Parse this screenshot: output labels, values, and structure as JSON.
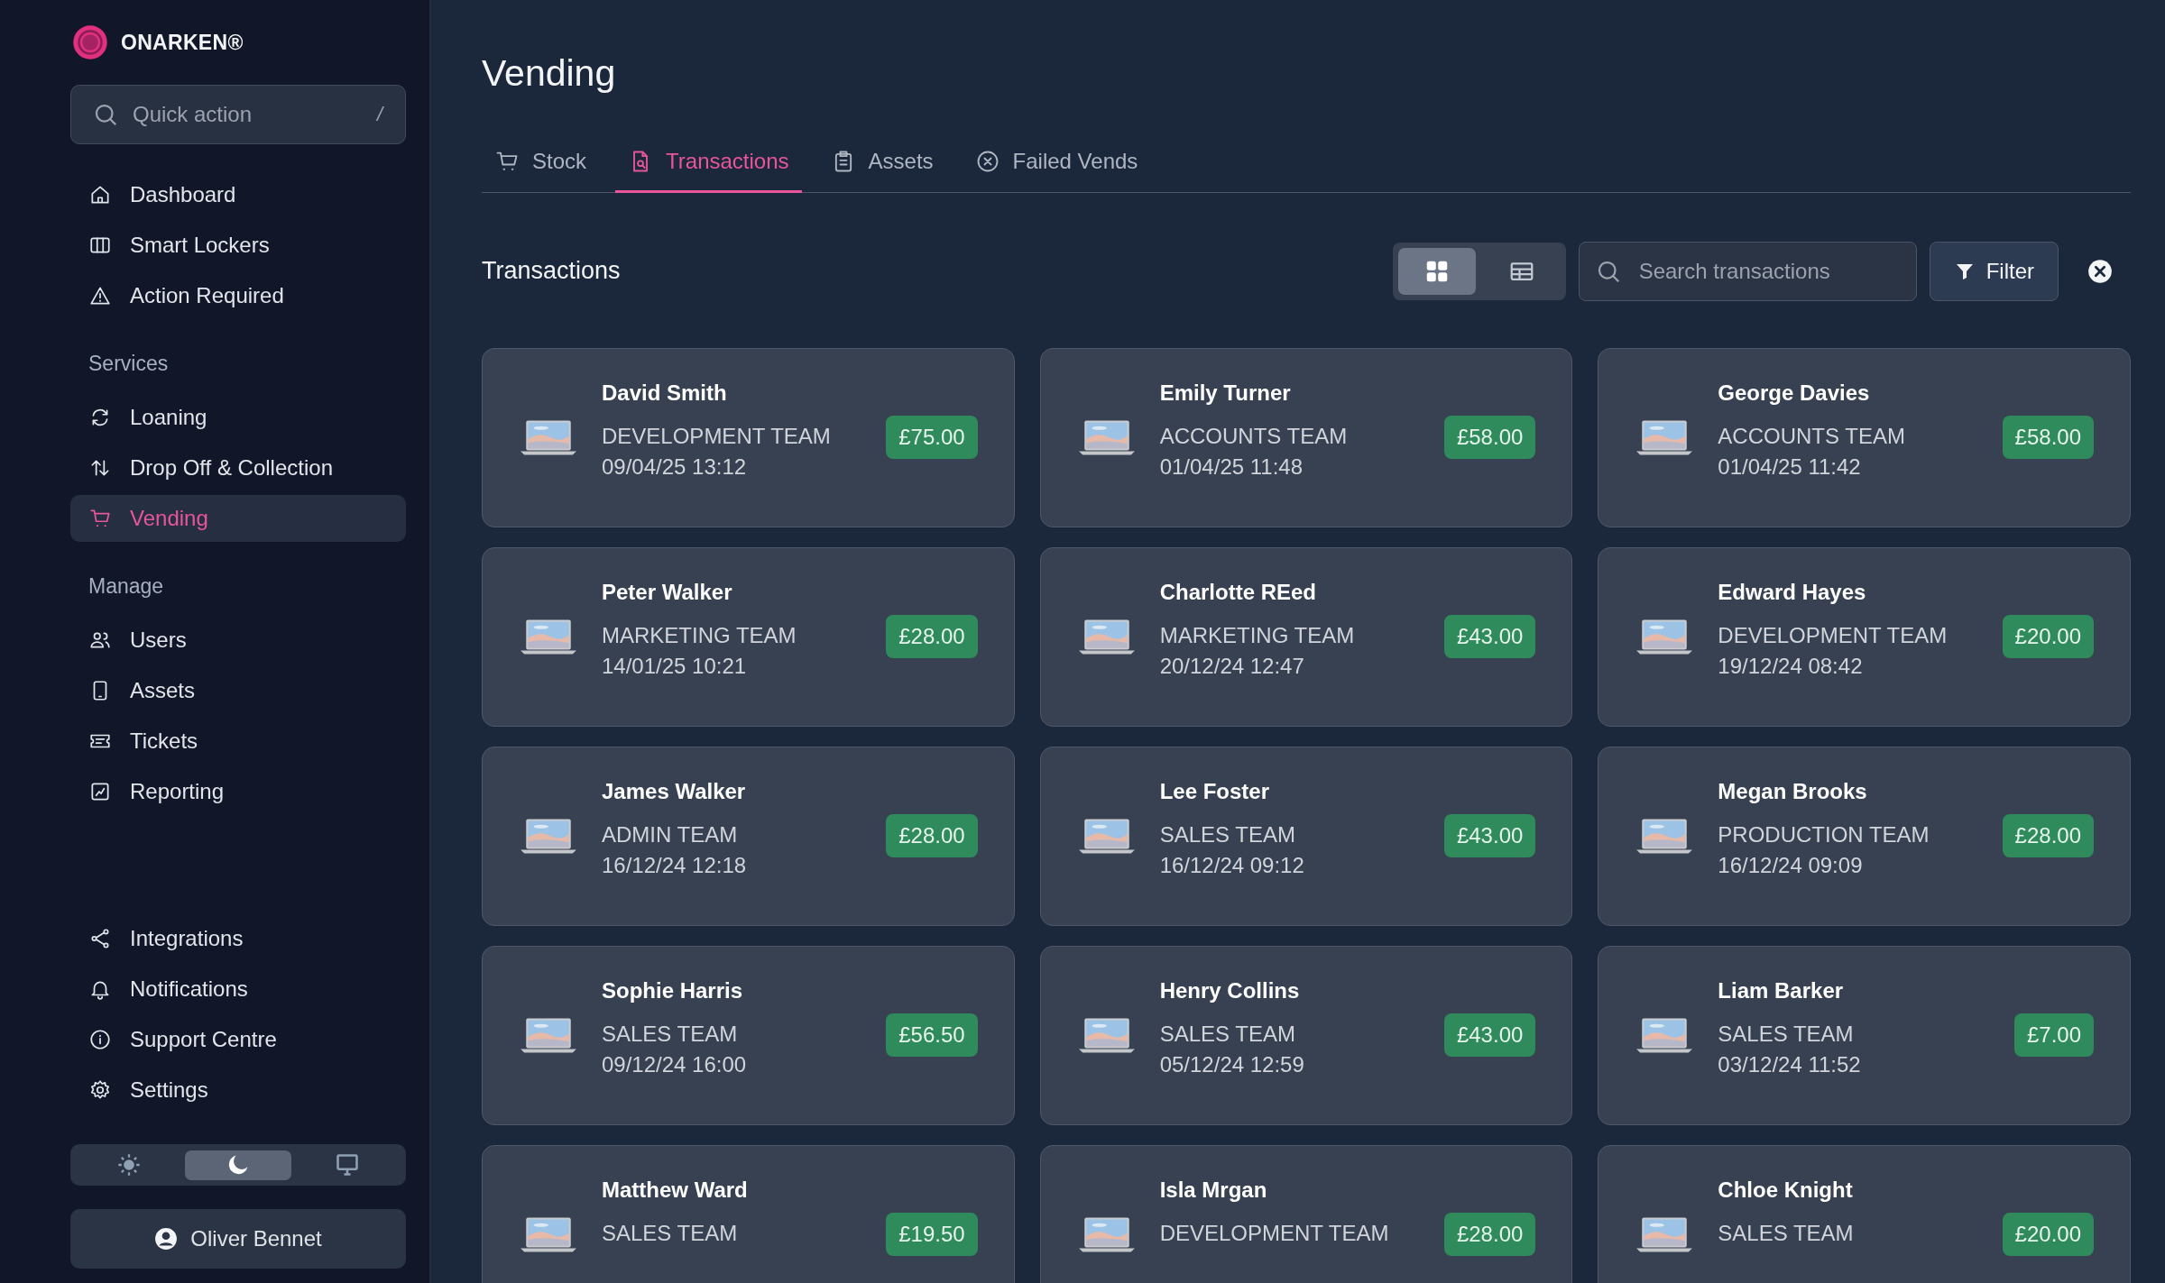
{
  "brand": {
    "name": "ONARKEN®"
  },
  "quick_action": {
    "placeholder": "Quick action",
    "shortcut": "/"
  },
  "sidebar": {
    "sections": [
      {
        "items": [
          {
            "label": "Dashboard",
            "selected": false
          },
          {
            "label": "Smart Lockers",
            "selected": false
          },
          {
            "label": "Action Required",
            "selected": false
          }
        ]
      },
      {
        "heading": "Services",
        "items": [
          {
            "label": "Loaning",
            "selected": false
          },
          {
            "label": "Drop Off & Collection",
            "selected": false
          },
          {
            "label": "Vending",
            "selected": true
          }
        ]
      },
      {
        "heading": "Manage",
        "items": [
          {
            "label": "Users",
            "selected": false
          },
          {
            "label": "Assets",
            "selected": false
          },
          {
            "label": "Tickets",
            "selected": false
          },
          {
            "label": "Reporting",
            "selected": false
          }
        ]
      },
      {
        "items": [
          {
            "label": "Integrations",
            "selected": false
          },
          {
            "label": "Notifications",
            "selected": false
          },
          {
            "label": "Support Centre",
            "selected": false
          },
          {
            "label": "Settings",
            "selected": false
          }
        ]
      }
    ],
    "theme_options": [
      {
        "kind": "light",
        "selected": false
      },
      {
        "kind": "dark",
        "selected": true
      },
      {
        "kind": "system",
        "selected": false
      }
    ],
    "user": "Oliver Bennet"
  },
  "page": {
    "title": "Vending"
  },
  "tabs": [
    {
      "label": "Stock",
      "selected": false
    },
    {
      "label": "Transactions",
      "selected": true
    },
    {
      "label": "Assets",
      "selected": false
    },
    {
      "label": "Failed Vends",
      "selected": false
    }
  ],
  "section": {
    "title": "Transactions",
    "views": [
      {
        "kind": "grid",
        "selected": true
      },
      {
        "kind": "table",
        "selected": false
      }
    ],
    "search": {
      "placeholder": "Search transactions"
    },
    "filter_button": "Filter"
  },
  "transactions": [
    {
      "name": "David Smith",
      "team": "DEVELOPMENT TEAM",
      "date": "09/04/25 13:12",
      "amount": "£75.00"
    },
    {
      "name": "Emily Turner",
      "team": "ACCOUNTS TEAM",
      "date": "01/04/25 11:48",
      "amount": "£58.00"
    },
    {
      "name": "George Davies",
      "team": "ACCOUNTS TEAM",
      "date": "01/04/25 11:42",
      "amount": "£58.00"
    },
    {
      "name": "Peter Walker",
      "team": "MARKETING TEAM",
      "date": "14/01/25 10:21",
      "amount": "£28.00"
    },
    {
      "name": "Charlotte REed",
      "team": "MARKETING TEAM",
      "date": "20/12/24 12:47",
      "amount": "£43.00"
    },
    {
      "name": "Edward Hayes",
      "team": "DEVELOPMENT TEAM",
      "date": "19/12/24 08:42",
      "amount": "£20.00"
    },
    {
      "name": "James Walker",
      "team": "ADMIN TEAM",
      "date": "16/12/24 12:18",
      "amount": "£28.00"
    },
    {
      "name": "Lee Foster",
      "team": "SALES TEAM",
      "date": "16/12/24 09:12",
      "amount": "£43.00"
    },
    {
      "name": "Megan Brooks",
      "team": "PRODUCTION TEAM",
      "date": "16/12/24 09:09",
      "amount": "£28.00"
    },
    {
      "name": "Sophie Harris",
      "team": "SALES TEAM",
      "date": "09/12/24 16:00",
      "amount": "£56.50"
    },
    {
      "name": "Henry Collins",
      "team": "SALES TEAM",
      "date": "05/12/24 12:59",
      "amount": "£43.00"
    },
    {
      "name": "Liam Barker",
      "team": "SALES TEAM",
      "date": "03/12/24 11:52",
      "amount": "£7.00"
    },
    {
      "name": "Matthew Ward",
      "team": "SALES TEAM",
      "amount": "£19.50"
    },
    {
      "name": "Isla Mrgan",
      "team": "DEVELOPMENT TEAM",
      "amount": "£28.00"
    },
    {
      "name": "Chloe Knight",
      "team": "SALES TEAM",
      "amount": "£20.00"
    }
  ]
}
